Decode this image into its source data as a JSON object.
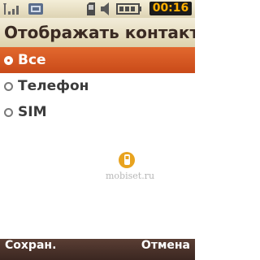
{
  "status": {
    "icons": [
      "signal-icon",
      "sim-icon",
      "memory-card-icon",
      "volume-icon",
      "battery-icon"
    ],
    "time": "00:16"
  },
  "title": "Отображать контакты",
  "options": [
    {
      "label": "Все",
      "selected": true
    },
    {
      "label": "Телефон",
      "selected": false
    },
    {
      "label": "SIM",
      "selected": false
    }
  ],
  "watermark": {
    "text": "mobiset.ru"
  },
  "softkeys": {
    "left": "Сохран.",
    "right": "Отмена"
  },
  "colors": {
    "accent": "#d85a23",
    "softkey_bg": "#4a322a",
    "clock_text": "#ffb000"
  }
}
